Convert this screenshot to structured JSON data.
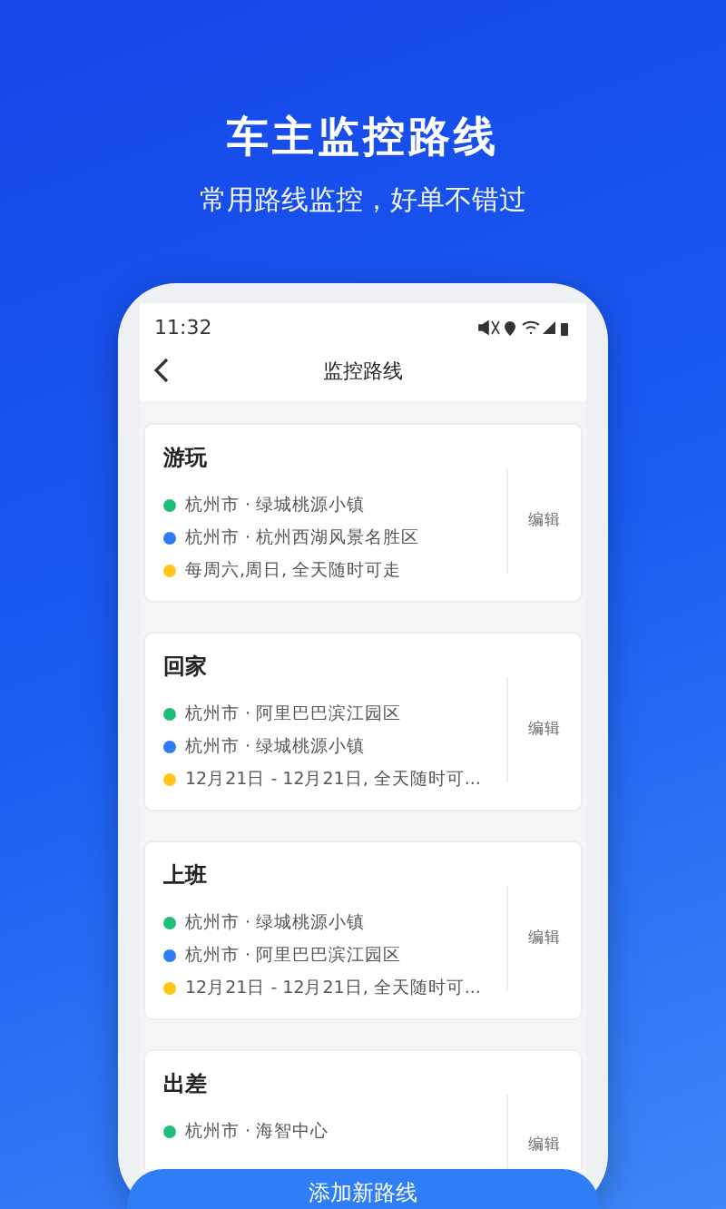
{
  "header": {
    "title": "车主监控路线",
    "subtitle": "常用路线监控，好单不错过"
  },
  "status_bar": {
    "time": "11:32"
  },
  "nav": {
    "title": "监控路线"
  },
  "routes": [
    {
      "name": "游玩",
      "edit": "编辑",
      "lines": [
        {
          "text": "杭州市 · 绿城桃源小镇",
          "color": "#1fbf7a"
        },
        {
          "text": "杭州市 · 杭州西湖风景名胜区",
          "color": "#2f7cf6"
        },
        {
          "text": "每周六,周日, 全天随时可走",
          "color": "#ffc61a"
        }
      ]
    },
    {
      "name": "回家",
      "edit": "编辑",
      "lines": [
        {
          "text": "杭州市 · 阿里巴巴滨江园区",
          "color": "#1fbf7a"
        },
        {
          "text": "杭州市 · 绿城桃源小镇",
          "color": "#2f7cf6"
        },
        {
          "text": "12月21日 - 12月21日, 全天随时可...",
          "color": "#ffc61a"
        }
      ]
    },
    {
      "name": "上班",
      "edit": "编辑",
      "lines": [
        {
          "text": "杭州市 · 绿城桃源小镇",
          "color": "#1fbf7a"
        },
        {
          "text": "杭州市 · 阿里巴巴滨江园区",
          "color": "#2f7cf6"
        },
        {
          "text": "12月21日 - 12月21日, 全天随时可...",
          "color": "#ffc61a"
        }
      ]
    },
    {
      "name": "出差",
      "edit": "编辑",
      "lines": [
        {
          "text": "杭州市 · 海智中心",
          "color": "#1fbf7a"
        }
      ]
    }
  ],
  "add_button": {
    "label": "添加新路线"
  }
}
